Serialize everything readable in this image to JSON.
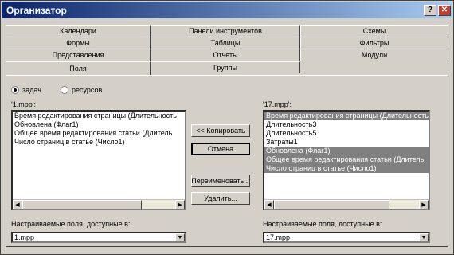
{
  "window": {
    "title": "Организатор",
    "help_glyph": "?",
    "close_glyph": "✕"
  },
  "tabs": {
    "row1": [
      "Календари",
      "Панели инструментов",
      "Схемы"
    ],
    "row2": [
      "Формы",
      "Таблицы",
      "Фильтры"
    ],
    "row3": [
      "Представления",
      "Отчеты",
      "Модули"
    ],
    "row4": [
      "Поля",
      "Группы"
    ],
    "active": "Поля"
  },
  "options": {
    "task_label": "задач",
    "resource_label": "ресурсов",
    "selected": "задач"
  },
  "left": {
    "label": "'1.mpp':",
    "items": [
      "Время редактирования страницы (Длительность",
      "Обновлена (Флаг1)",
      "Общее время редактирования статьи (Длитель",
      "Число страниц в статье (Число1)"
    ],
    "fields_label": "Настраиваемые поля, доступные в:",
    "combo_value": "1.mpp"
  },
  "right": {
    "label": "'17.mpp':",
    "items": [
      "Время редактирования страницы (Длительность",
      "Длительность3",
      "Длительность5",
      "Затраты1",
      "Обновлена (Флаг1)",
      "Общее время редактирования статьи (Длитель",
      "Число страниц в статье (Число1)"
    ],
    "selected": [
      0,
      4,
      5,
      6
    ],
    "fields_label": "Настраиваемые поля, доступные в:",
    "combo_value": "17.mpp"
  },
  "buttons": {
    "copy": "<< Копировать",
    "cancel": "Отмена",
    "rename": "Переименовать...",
    "delete": "Удалить..."
  }
}
